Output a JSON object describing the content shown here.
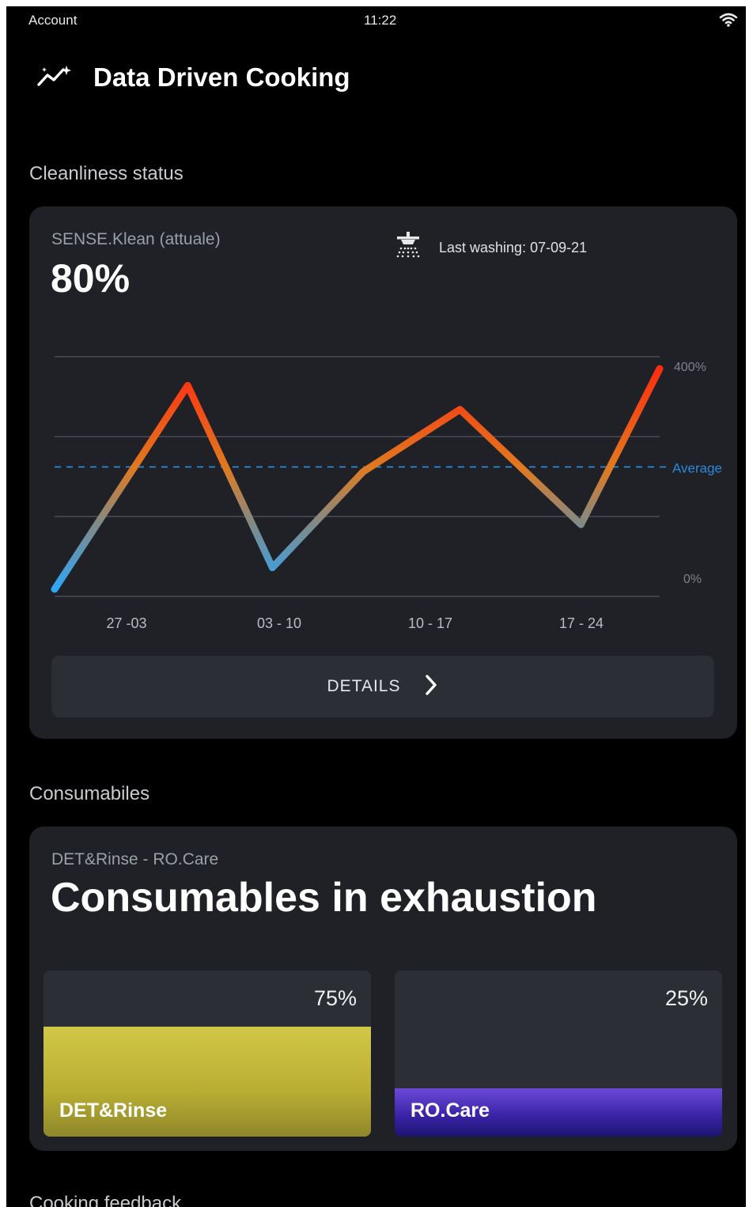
{
  "status_bar": {
    "left": "Account",
    "time": "11:22"
  },
  "header": {
    "title": "Data Driven Cooking",
    "icon": "trend-sparkle-icon"
  },
  "cleanliness": {
    "section_title": "Cleanliness status",
    "subtitle": "SENSE.Klean (attuale)",
    "value": "80%",
    "last_washing": "Last washing: 07-09-21",
    "details_label": "DETAILS"
  },
  "chart_data": {
    "type": "line",
    "categories": [
      "27 -03",
      "03 - 10",
      "10 - 17",
      "17 - 24"
    ],
    "x": [
      0,
      0.22,
      0.36,
      0.51,
      0.67,
      0.87,
      1.0
    ],
    "y": [
      3,
      88,
      12,
      52,
      78,
      30,
      95
    ],
    "ylim": [
      0,
      100
    ],
    "ytick_labels": [
      "400%",
      "0%"
    ],
    "reference_line": {
      "label": "Average",
      "value": 54,
      "style": "dashed",
      "color": "#2a8ad8"
    },
    "grid": true,
    "colors": {
      "low": "#2aa8ff",
      "mid": "#e07a20",
      "high": "#ff2a10"
    }
  },
  "consumables": {
    "section_title": "Consumabiles",
    "subtitle": "DET&Rinse - RO.Care",
    "title": "Consumables in exhaustion",
    "items": [
      {
        "name": "DET&Rinse",
        "percent_label": "75%",
        "fill": 0.66,
        "color": "#c9bf3e"
      },
      {
        "name": "RO.Care",
        "percent_label": "25%",
        "fill": 0.29,
        "color": "#3b24a8"
      }
    ]
  },
  "next_section": {
    "title": "Cooking feedback"
  }
}
